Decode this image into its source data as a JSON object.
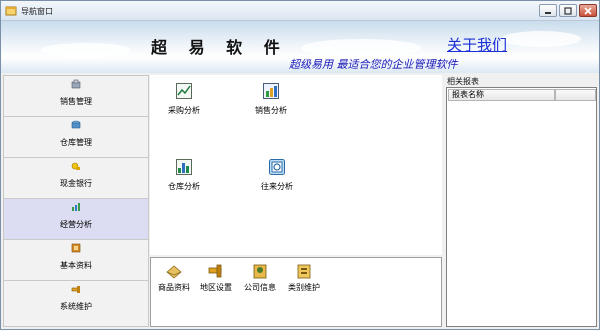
{
  "window": {
    "title": "导航窗口"
  },
  "banner": {
    "brand": "超 易 软 件",
    "about_link": "关于我们",
    "slogan": "超级易用 最适合您的企业管理软件"
  },
  "nav": {
    "items": [
      {
        "label": "销售管理",
        "icon": "sales-icon"
      },
      {
        "label": "仓库管理",
        "icon": "warehouse-icon"
      },
      {
        "label": "现金银行",
        "icon": "cash-bank-icon"
      },
      {
        "label": "经营分析",
        "icon": "analysis-icon",
        "selected": true
      },
      {
        "label": "基本资料",
        "icon": "basic-data-icon"
      },
      {
        "label": "系统维护",
        "icon": "system-maintenance-icon"
      }
    ]
  },
  "main": {
    "tiles": [
      {
        "label": "采购分析",
        "icon": "purchase-analysis-icon"
      },
      {
        "label": "销售分析",
        "icon": "sales-analysis-icon"
      },
      {
        "label": "仓库分析",
        "icon": "warehouse-analysis-icon"
      },
      {
        "label": "往来分析",
        "icon": "accounts-analysis-icon"
      }
    ]
  },
  "shortcuts": {
    "items": [
      {
        "label": "商品资料",
        "icon": "product-data-icon"
      },
      {
        "label": "地区设置",
        "icon": "region-settings-icon"
      },
      {
        "label": "公司信息",
        "icon": "company-info-icon"
      },
      {
        "label": "类别维护",
        "icon": "category-maintenance-icon"
      }
    ]
  },
  "right_panel": {
    "title": "相关报表",
    "columns": [
      "报表名称",
      ""
    ]
  },
  "colors": {
    "about_link": "#1a2fd6",
    "slogan": "#1a1ab8",
    "nav_selected": "#dcdcf3"
  }
}
